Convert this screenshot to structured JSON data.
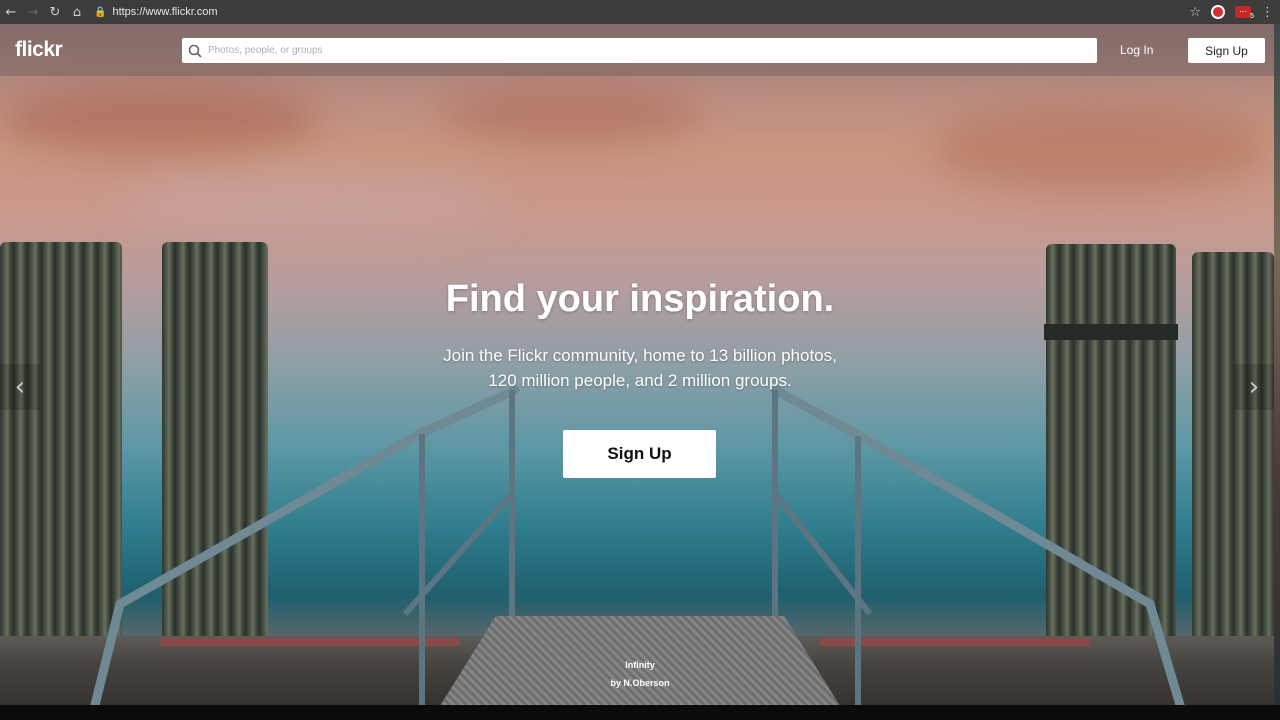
{
  "browser": {
    "url": "https://www.flickr.com",
    "back_icon": "back-arrow-icon",
    "forward_icon": "forward-arrow-icon",
    "reload_icon": "reload-icon",
    "home_icon": "home-icon",
    "extension_badge": "5"
  },
  "header": {
    "logo": "flickr",
    "search_placeholder": "Photos, people, or groups",
    "login_label": "Log In",
    "signup_label": "Sign Up"
  },
  "hero": {
    "title": "Find your inspiration.",
    "subtitle_line1": "Join the Flickr community, home to 13 billion photos,",
    "subtitle_line2": "120 million people, and 2 million groups.",
    "signup_label": "Sign Up"
  },
  "photo_credit": {
    "title": "Infinity",
    "author": "by N.Oberson"
  },
  "colors": {
    "accent": "#ffffff",
    "chrome_bg": "#3c3c3c"
  }
}
